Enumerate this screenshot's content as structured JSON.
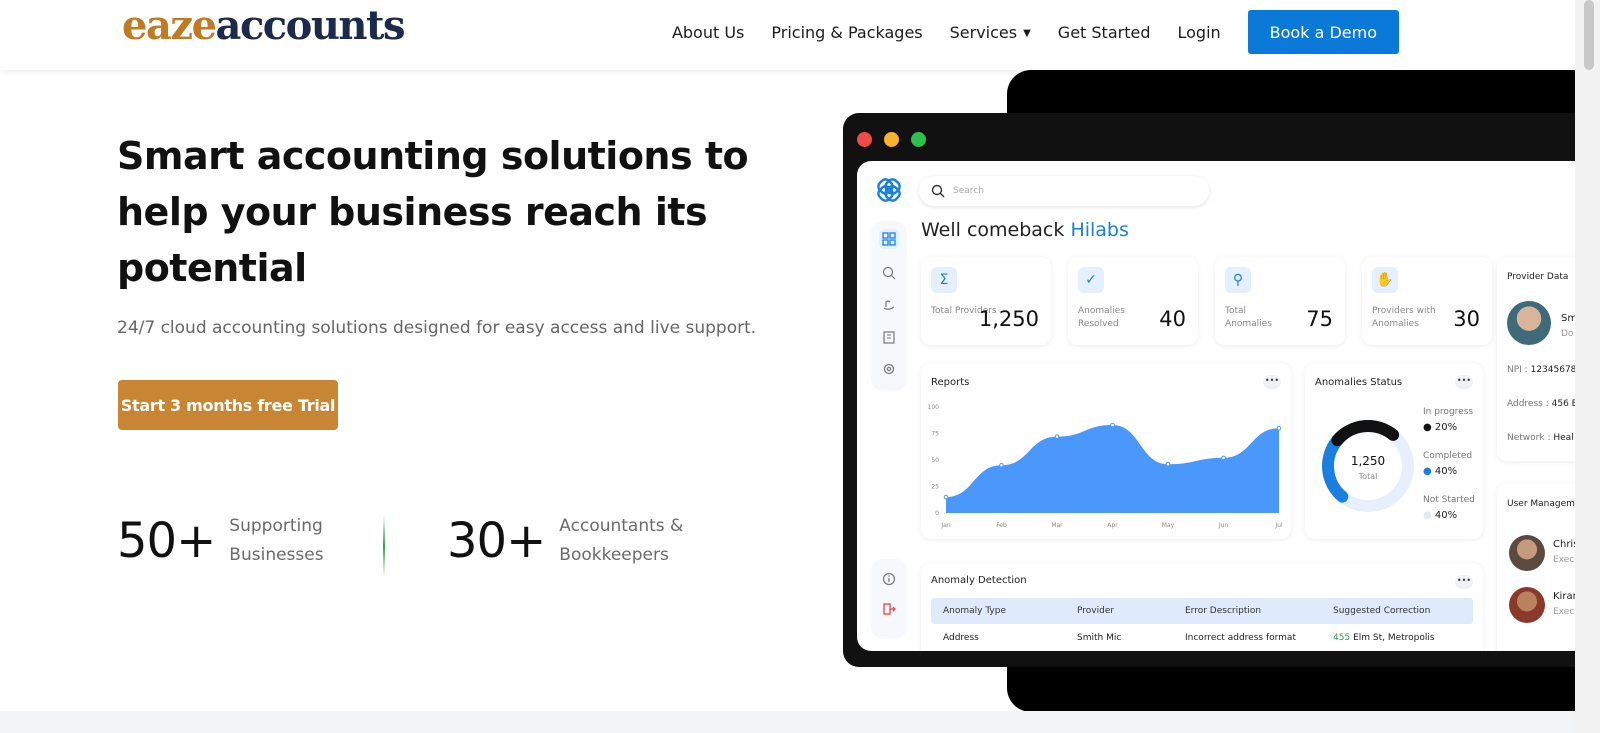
{
  "logo": {
    "part1": "eaze",
    "part2": "accounts"
  },
  "nav": {
    "links": [
      "About Us",
      "Pricing & Packages",
      "Services",
      "Get Started",
      "Login"
    ],
    "services_chevron": "chevron-down-icon",
    "cta": "Book a Demo"
  },
  "hero": {
    "title": "Smart accounting solutions to help your business reach its potential",
    "subtitle": "24/7 cloud accounting solutions designed for easy access and live support.",
    "cta": "Start 3 months free Trial",
    "stats": [
      {
        "value": "50+",
        "label_line1": "Supporting",
        "label_line2": "Businesses"
      },
      {
        "value": "30+",
        "label_line1": "Accountants &",
        "label_line2": "Bookkeepers"
      }
    ]
  },
  "dashboard": {
    "search_placeholder": "Search",
    "welcome_prefix": "Well comeback",
    "welcome_name": "Hilabs",
    "cards": [
      {
        "label": "Total Providers",
        "value": "1,250",
        "icon": "sigma-icon"
      },
      {
        "label": "Anomalies Resolved",
        "value": "40",
        "icon": "check-badge-icon"
      },
      {
        "label": "Total Anomalies",
        "value": "75",
        "icon": "magnifier-icon"
      },
      {
        "label": "Providers with Anomalies",
        "value": "30",
        "icon": "hand-icon"
      }
    ],
    "reports": {
      "title": "Reports",
      "more": "•••"
    },
    "anomalies_status": {
      "title": "Anomalies Status",
      "more": "•••",
      "center_value": "1,250",
      "center_label": "Total",
      "items": [
        {
          "label": "In progress",
          "value": "20%",
          "color": "#111111"
        },
        {
          "label": "Completed",
          "value": "40%",
          "color": "#1b7fe0"
        },
        {
          "label": "Not Started",
          "value": "40%",
          "color": "#dfe9fb"
        }
      ]
    },
    "anomaly_detection": {
      "title": "Anomaly Detection",
      "more": "•••",
      "headers": [
        "Anomaly Type",
        "Provider",
        "Error Description",
        "Suggested Correction"
      ],
      "row": [
        "Address",
        "Smith Mic",
        "Incorrect address format",
        "455",
        "Elm St, Metropolis"
      ]
    },
    "provider_data": {
      "title": "Provider Data",
      "name": "Sm",
      "role": "Do",
      "npi_label": "NPI :",
      "npi_value": "12345678",
      "address_label": "Address :",
      "address_value": "456 E",
      "network_label": "Network :",
      "network_value": "Heal"
    },
    "user_management": {
      "title": "User Managem",
      "users": [
        {
          "name": "Chris",
          "role": "Execu"
        },
        {
          "name": "Kiran",
          "role": "Execu"
        }
      ]
    }
  },
  "chart_data": {
    "type": "area",
    "title": "Reports",
    "categories": [
      "Jan",
      "Feb",
      "Mar",
      "Apr",
      "May",
      "Jun",
      "Jul"
    ],
    "y_ticks": [
      "100",
      "75",
      "50",
      "25",
      "0"
    ],
    "values": [
      15,
      45,
      72,
      83,
      46,
      52,
      80
    ],
    "ylim": [
      0,
      100
    ],
    "color": "#4a98fb"
  },
  "colors": {
    "brand_gold": "#c88534",
    "brand_blue": "#0b79d8",
    "navy": "#1d2a4b"
  }
}
